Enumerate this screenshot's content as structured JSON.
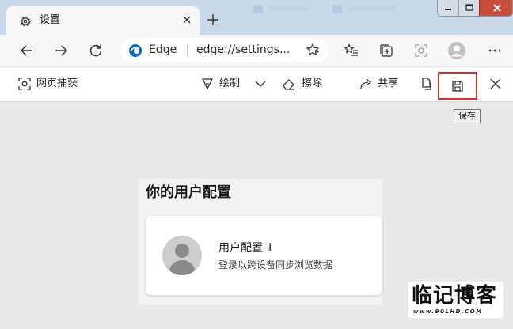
{
  "colors": {
    "tabstrip_bg": "#c9d9ea",
    "toolbar_bg": "#f7f7f7",
    "page_bg": "#e9e9e9",
    "highlight": "#d0312d",
    "window_close": "#c84d3b",
    "edge_logo": "#0b67b8"
  },
  "tab": {
    "title": "设置",
    "icon": "gear-icon",
    "close_label": "✕",
    "new_tab_label": "+"
  },
  "window_controls": [
    "minimize-icon",
    "maximize-icon",
    "close-icon"
  ],
  "address_bar": {
    "site_label": "Edge",
    "url": "edge://settings...",
    "favorite_icon": "star-icon"
  },
  "nav_icons": [
    "back-arrow-icon",
    "forward-arrow-icon",
    "refresh-icon"
  ],
  "toolbar_icons": [
    "favorites-list-icon",
    "collections-icon",
    "web-capture-icon",
    "profile-icon",
    "more-icon"
  ],
  "capture_toolbar": {
    "title": "网页捕获",
    "draw_label": "绘制",
    "erase_label": "擦除",
    "share_label": "共享",
    "copy_icon": "copy-icon",
    "save_icon": "save-icon",
    "close_icon": "close-icon",
    "save_tooltip": "保存"
  },
  "profile": {
    "heading": "你的用户配置",
    "name": "用户配置 1",
    "description": "登录以跨设备同步浏览数据"
  },
  "watermark": {
    "logo_text": "临记博客",
    "url_text": "www.90LHD.COM"
  }
}
